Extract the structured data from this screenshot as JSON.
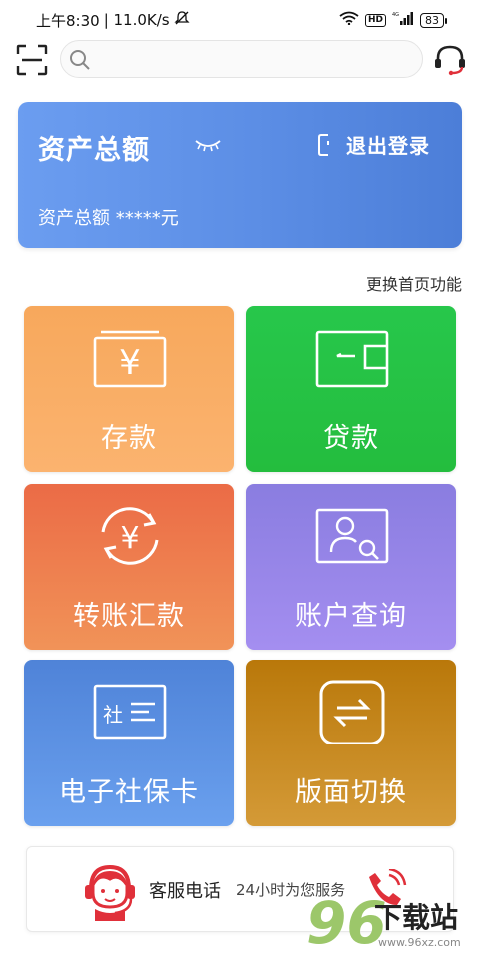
{
  "status_bar": {
    "time": "上午8:30",
    "speed": "| 11.0K/s",
    "hd": "HD",
    "signal_label": "4G",
    "battery": "83"
  },
  "search": {
    "placeholder": ""
  },
  "asset_card": {
    "title": "资产总额",
    "logout_label": "退出登录",
    "amount": "资产总额 *****元"
  },
  "change_home_label": "更换首页功能",
  "tiles": [
    {
      "label": "存款",
      "icon": "yuan-card-icon"
    },
    {
      "label": "贷款",
      "icon": "wallet-icon"
    },
    {
      "label": "转账汇款",
      "icon": "yuan-cycle-icon"
    },
    {
      "label": "账户查询",
      "icon": "user-search-icon"
    },
    {
      "label": "电子社保卡",
      "icon": "social-card-icon"
    },
    {
      "label": "版面切换",
      "icon": "swap-icon"
    }
  ],
  "hotline": {
    "title": "客服电话",
    "subtitle": "24小时为您服务"
  },
  "watermark": {
    "number": "96",
    "text": "下载站",
    "url": "www.96xz.com"
  },
  "colors": {
    "asset_card": "#5d8fe6",
    "deposit": "#f9ad65",
    "loan": "#26c245",
    "transfer": "#ee7d4f",
    "account": "#9785e8",
    "social": "#5b90e2",
    "switch": "#c48920",
    "hotline_red": "#e0303a"
  }
}
